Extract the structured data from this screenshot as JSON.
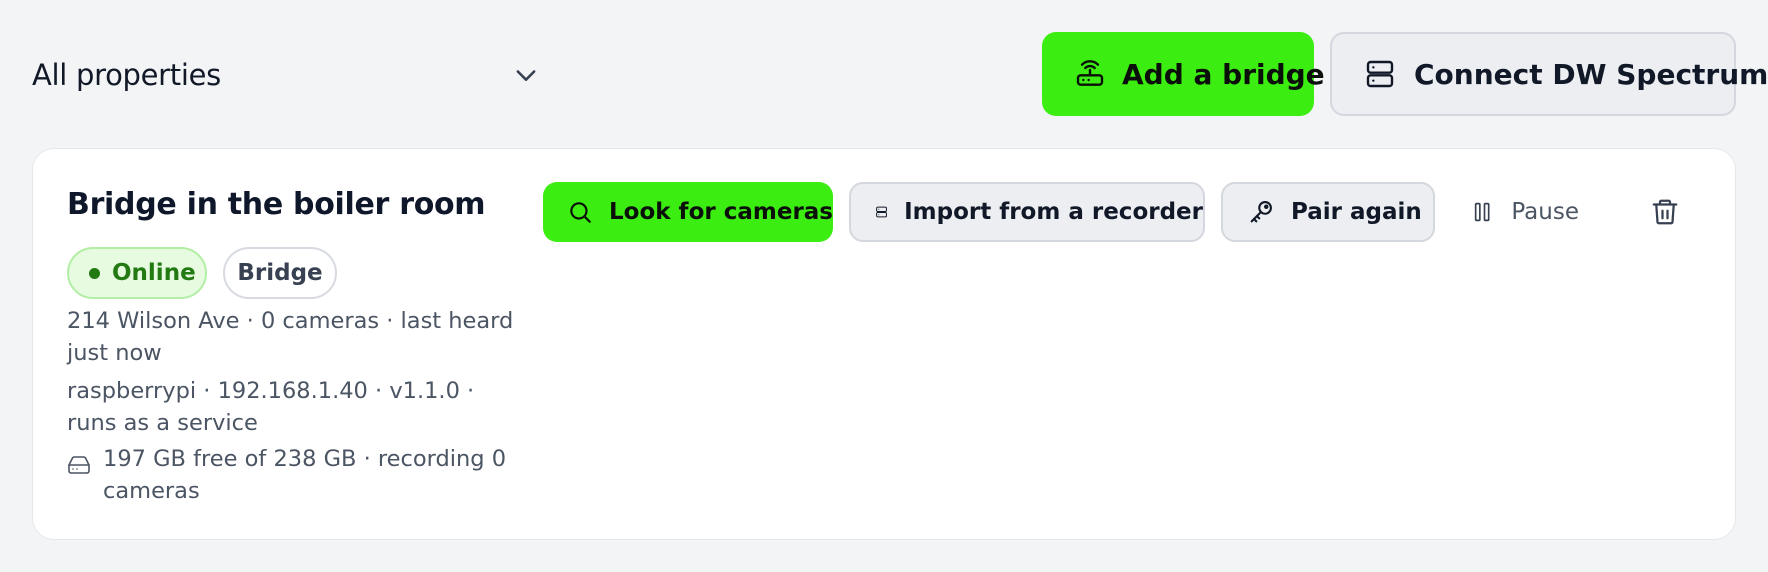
{
  "toolbar": {
    "property_filter": "All properties",
    "add_bridge_label": "Add a bridge",
    "connect_dw_label": "Connect DW Spectrum"
  },
  "bridge_card": {
    "title": "Bridge in the boiler room",
    "status_badge": "Online",
    "type_badge": "Bridge",
    "meta_location": "214 Wilson Ave · 0 cameras · last heard just now",
    "meta_host": "raspberrypi · 192.168.1.40 · v1.1.0 · runs as a service",
    "meta_storage": "197 GB free of 238 GB · recording 0 cameras",
    "actions": {
      "look_label": "Look for cameras",
      "import_label": "Import from a recorder",
      "pair_label": "Pair again",
      "pause_label": "Pause"
    }
  },
  "icons": {
    "dropdown": "chevron-down-icon",
    "add_bridge": "router-icon",
    "connect_dw": "server-icon",
    "look": "search-icon",
    "import": "server-icon",
    "pair": "key-icon",
    "pause": "pause-icon",
    "delete": "trash-icon",
    "storage": "hard-drive-icon"
  },
  "colors": {
    "accent_green": "#3ced12",
    "online_text": "#237a13",
    "online_bg": "#e6fbe0",
    "page_bg": "#f3f4f6"
  }
}
